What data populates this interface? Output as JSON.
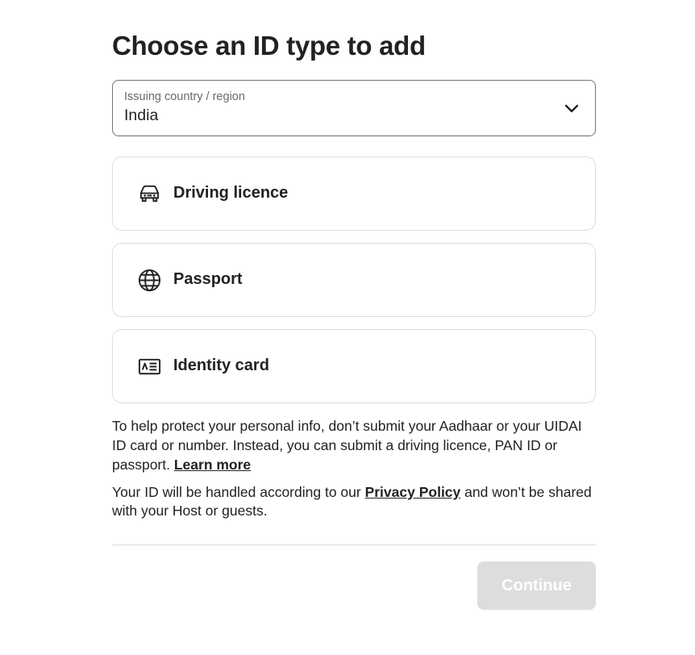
{
  "page": {
    "title": "Choose an ID type to add"
  },
  "country_select": {
    "label": "Issuing country / region",
    "value": "India",
    "icon": "chevron-down-icon"
  },
  "id_options": [
    {
      "label": "Driving licence",
      "icon": "car-icon"
    },
    {
      "label": "Passport",
      "icon": "globe-icon"
    },
    {
      "label": "Identity card",
      "icon": "id-card-icon"
    }
  ],
  "notice": {
    "text": "To help protect your personal info, don’t submit your Aadhaar or your UIDAI ID card or number. Instead, you can submit a driving licence, PAN ID or passport. ",
    "learn_more": "Learn more"
  },
  "privacy": {
    "before": "Your ID will be handled according to our ",
    "link": "Privacy Policy",
    "after": " and won’t be shared with your Host or guests."
  },
  "footer": {
    "continue_label": "Continue",
    "continue_enabled": false
  },
  "colors": {
    "text": "#222222",
    "muted": "#6a6a6a",
    "border": "#dddddd",
    "disabled_button": "#dddddd"
  }
}
